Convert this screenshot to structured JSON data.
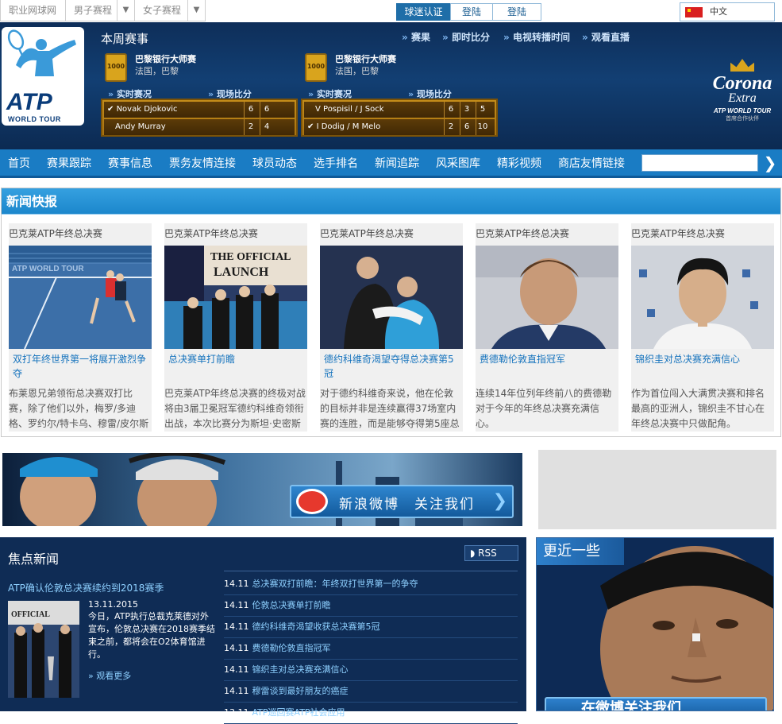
{
  "topbar": {
    "tabs": [
      "职业网球网",
      "男子赛程",
      "女子赛程"
    ],
    "buttons": [
      "球迷认证",
      "登陆",
      "登陆"
    ],
    "language": "中文"
  },
  "header": {
    "week_title": "本周赛事",
    "links": [
      "赛果",
      "即时比分",
      "电视转播时间",
      "观看直播"
    ],
    "events": [
      {
        "badge": "1000",
        "name": "巴黎银行大师赛",
        "location": "法国，巴黎",
        "live_label": "实时赛况",
        "score_label": "现场比分",
        "rows": [
          {
            "check": "✔",
            "player": "Novak Djokovic",
            "sets": [
              "6",
              "6"
            ]
          },
          {
            "check": "",
            "player": "Andy Murray",
            "sets": [
              "2",
              "4"
            ]
          }
        ]
      },
      {
        "badge": "1000",
        "name": "巴黎银行大师赛",
        "location": "法国，巴黎",
        "live_label": "实时赛况",
        "score_label": "现场比分",
        "rows": [
          {
            "check": "",
            "player": "V Pospisil / J Sock",
            "sets": [
              "6",
              "3",
              "5"
            ]
          },
          {
            "check": "✔",
            "player": "I Dodig / M Melo",
            "sets": [
              "2",
              "6",
              "10"
            ]
          }
        ]
      }
    ],
    "logo": {
      "atp": "ATP",
      "world_tour": "WORLD TOUR"
    },
    "sponsor": {
      "brand": "Corona",
      "sub": "Extra",
      "tag": "ATP WORLD TOUR",
      "tag2": "首席合作伙伴"
    }
  },
  "nav": {
    "items": [
      "首页",
      "赛果跟踪",
      "赛事信息",
      "票务友情连接",
      "球员动态",
      "选手排名",
      "新闻追踪",
      "风采图库",
      "精彩视频",
      "商店友情链接"
    ],
    "search_placeholder": "",
    "search_button": "❯"
  },
  "newsflash": {
    "title": "新闻快报",
    "cards": [
      {
        "category": "巴克莱ATP年终总决赛",
        "title": "双打年终世界第一将展开激烈争夺",
        "desc": "布莱恩兄弟领衔总决赛双打比赛，除了他们以外，梅罗/多迪格、罗约尔/特卡乌、穆雷/皮尔斯"
      },
      {
        "category": "巴克莱ATP年终总决赛",
        "title": "总决赛单打前瞻",
        "desc": "巴克莱ATP年终总决赛的终极对战将由3届卫冕冠军德约科维奇领衔出战，本次比赛分为斯坦·史密斯组和伊利·纳斯塔斯组两组。"
      },
      {
        "category": "巴克莱ATP年终总决赛",
        "title": "德约科维奇渴望夺得总决赛第5冠",
        "desc": "对于德约科维奇来说，他在伦敦的目标并非是连续赢得37场室内赛的连胜，而是能够夺得第5座总"
      },
      {
        "category": "巴克莱ATP年终总决赛",
        "title": "费德勒伦敦直指冠军",
        "desc": "连续14年位列年终前八的费德勒对于今年的年终总决赛充满信心。"
      },
      {
        "category": "巴克莱ATP年终总决赛",
        "title": "锦织圭对总决赛充满信心",
        "desc": "作为首位闯入大满贯决赛和排名最高的亚洲人，锦织圭不甘心在年终总决赛中只做配角。"
      }
    ]
  },
  "banner": {
    "weibo_text": "新浪微博　关注我们"
  },
  "focus": {
    "title": "焦点新闻",
    "rss": "RSS",
    "lead_title": "ATP确认伦敦总决赛续约到2018赛季",
    "lead_date": "13.11.2015",
    "lead_text": "今日，ATP执行总裁克莱德对外宣布，伦敦总决赛在2018赛季结束之前，都将会在O2体育馆进行。",
    "more": "观看更多",
    "list": [
      {
        "date": "14.11",
        "title": "总决赛双打前瞻：年终双打世界第一的争夺"
      },
      {
        "date": "14.11",
        "title": "伦敦总决赛单打前瞻"
      },
      {
        "date": "14.11",
        "title": "德约科维奇渴望收获总决赛第5冠"
      },
      {
        "date": "14.11",
        "title": "费德勒伦敦直指冠军"
      },
      {
        "date": "14.11",
        "title": "锦织圭对总决赛充满信心"
      },
      {
        "date": "14.11",
        "title": "穆雷谈到最好朋友的癌症"
      },
      {
        "date": "13.11",
        "title": "ATP巡回赛ATP社会应用"
      }
    ]
  },
  "closer": {
    "title": "更近一些",
    "footer": "在微博关注我们"
  }
}
